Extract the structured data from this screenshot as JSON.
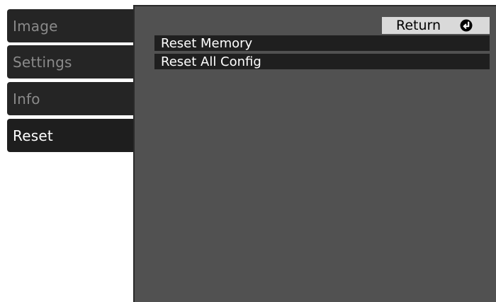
{
  "tabs": [
    {
      "label": "Image",
      "active": false
    },
    {
      "label": "Settings",
      "active": false
    },
    {
      "label": "Info",
      "active": false
    },
    {
      "label": "Reset",
      "active": true
    }
  ],
  "panel": {
    "return_label": "Return",
    "return_icon": "return-arrow-icon",
    "items": [
      {
        "label": "Reset Memory"
      },
      {
        "label": "Reset All Config"
      }
    ]
  },
  "colors": {
    "panel_bg": "#515151",
    "tab_bg": "#252525",
    "item_bg": "#1f1f1f",
    "return_bg": "#d9d9d9"
  }
}
